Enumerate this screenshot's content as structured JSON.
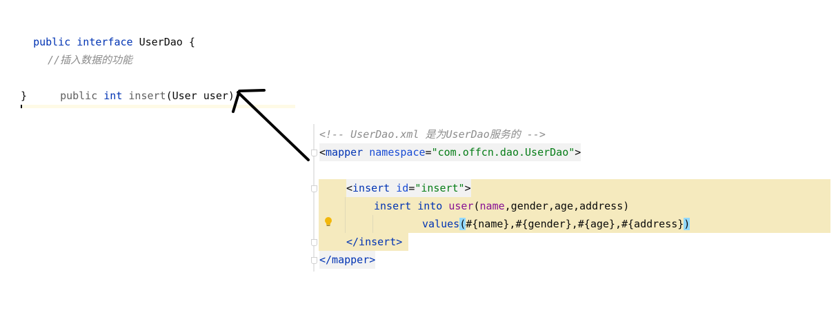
{
  "java": {
    "l1": {
      "kw1": "public",
      "kw2": "interface",
      "name": "UserDao",
      "brace": "{"
    },
    "comment": "//插入数据的功能",
    "l3": {
      "kw1": "public",
      "kw2": "int",
      "method": "insert",
      "args": "(User user);"
    },
    "close": "}"
  },
  "xml": {
    "comment": "<!-- UserDao.xml 是为UserDao服务的 -->",
    "mapper_open": {
      "lt": "<",
      "tag": "mapper",
      "attr": "namespace",
      "eq": "=",
      "val": "\"com.offcn.dao.UserDao\"",
      "gt": ">"
    },
    "insert_open": {
      "lt": "<",
      "tag": "insert",
      "attr": "id",
      "eq": "=",
      "val": "\"insert\"",
      "gt": ">"
    },
    "sql1": {
      "kw1": "insert",
      "kw2": "into",
      "table": "user",
      "paren_open": "(",
      "col1": "name",
      "rest": ",gender,age,address)"
    },
    "sql2": {
      "kw": "values",
      "paren_open": "(",
      "params": "#{name},#{gender},#{age},#{address}",
      "paren_close": ")"
    },
    "insert_close": {
      "text": "</insert>"
    },
    "mapper_close": {
      "text": "</mapper>"
    }
  },
  "icons": {
    "intention": "lightbulb-icon",
    "annotation": "arrow-annotation"
  },
  "colors": {
    "keyword": "#0033b3",
    "string": "#067d17",
    "comment": "#8c8c8c",
    "highlight": "#f5eabe",
    "brace_match": "#93d9ff"
  }
}
